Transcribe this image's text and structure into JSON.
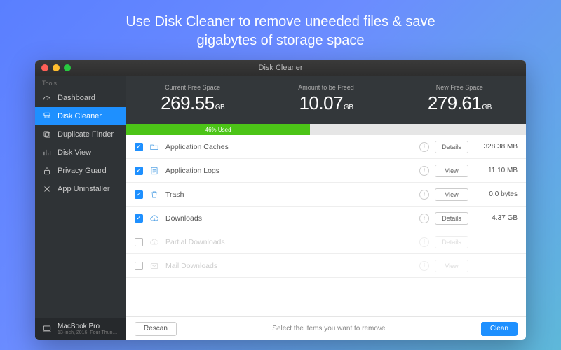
{
  "promo": {
    "line1": "Use Disk Cleaner to remove uneeded files & save",
    "line2": "gigabytes of storage space"
  },
  "window_title": "Disk Cleaner",
  "sidebar": {
    "header": "Tools",
    "items": [
      {
        "label": "Dashboard",
        "icon": "gauge-icon",
        "active": false
      },
      {
        "label": "Disk Cleaner",
        "icon": "brush-icon",
        "active": true
      },
      {
        "label": "Duplicate Finder",
        "icon": "copy-icon",
        "active": false
      },
      {
        "label": "Disk View",
        "icon": "chart-icon",
        "active": false
      },
      {
        "label": "Privacy Guard",
        "icon": "lock-icon",
        "active": false
      },
      {
        "label": "App Uninstaller",
        "icon": "tools-icon",
        "active": false
      }
    ],
    "machine": {
      "name": "MacBook Pro",
      "sub": "13-inch, 2016, Four Thun…"
    }
  },
  "stats": {
    "current": {
      "label": "Current Free Space",
      "value": "269.55",
      "unit": "GB"
    },
    "freed": {
      "label": "Amount to be Freed",
      "value": "10.07",
      "unit": "GB"
    },
    "new": {
      "label": "New Free Space",
      "value": "279.61",
      "unit": "GB"
    }
  },
  "usage": {
    "used_label": "46% Used",
    "used_pct": 46
  },
  "rows": [
    {
      "checked": true,
      "icon": "folder-icon",
      "name": "Application Caches",
      "action": "Details",
      "size": "328.38 MB",
      "disabled": false
    },
    {
      "checked": true,
      "icon": "log-icon",
      "name": "Application Logs",
      "action": "View",
      "size": "11.10 MB",
      "disabled": false
    },
    {
      "checked": true,
      "icon": "trash-icon",
      "name": "Trash",
      "action": "View",
      "size": "0.0 bytes",
      "disabled": false
    },
    {
      "checked": true,
      "icon": "cloud-icon",
      "name": "Downloads",
      "action": "Details",
      "size": "4.37 GB",
      "disabled": false
    },
    {
      "checked": false,
      "icon": "cloud-icon",
      "name": "Partial Downloads",
      "action": "Details",
      "size": "",
      "disabled": true
    },
    {
      "checked": false,
      "icon": "mail-icon",
      "name": "Mail Downloads",
      "action": "View",
      "size": "",
      "disabled": true
    }
  ],
  "footer": {
    "rescan": "Rescan",
    "message": "Select the items you want to remove",
    "clean": "Clean"
  }
}
